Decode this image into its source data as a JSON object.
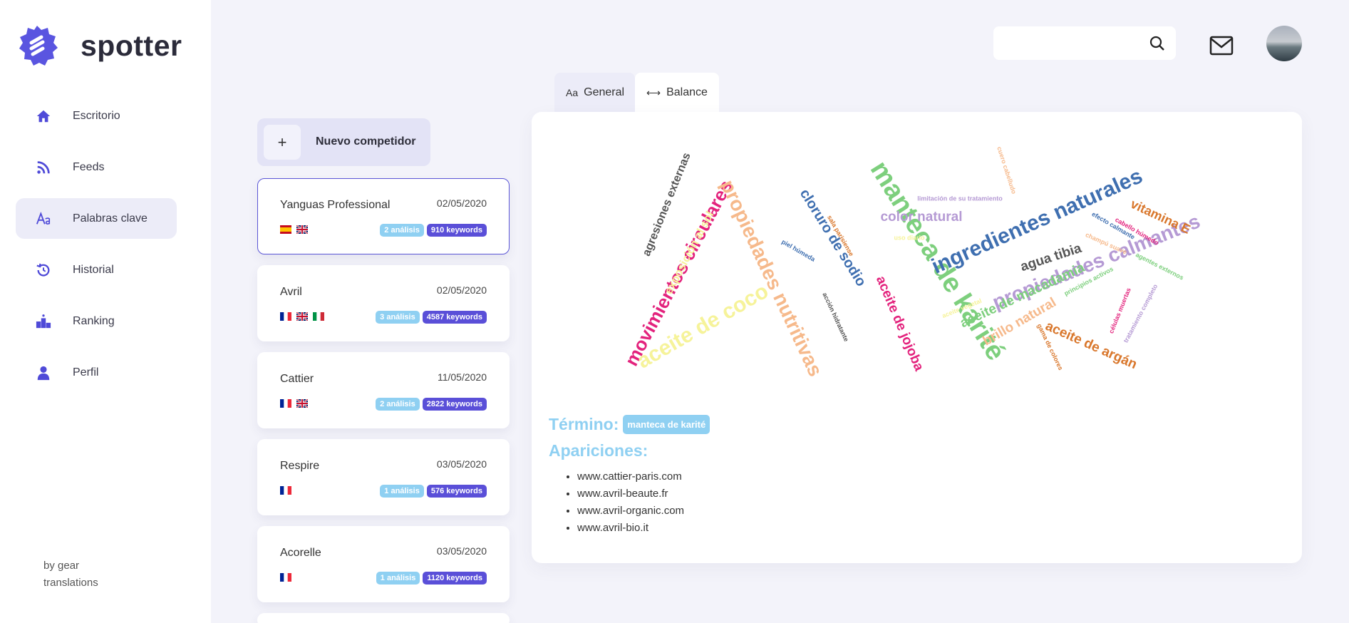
{
  "app": {
    "name": "spotter"
  },
  "sidebar": {
    "items": [
      {
        "label": "Escritorio",
        "icon": "home-icon"
      },
      {
        "label": "Feeds",
        "icon": "rss-icon"
      },
      {
        "label": "Palabras clave",
        "icon": "text-aa-icon",
        "active": true
      },
      {
        "label": "Historial",
        "icon": "history-icon"
      },
      {
        "label": "Ranking",
        "icon": "podium-icon"
      },
      {
        "label": "Perfil",
        "icon": "user-icon"
      }
    ],
    "credit": "by gear translations"
  },
  "header": {
    "search_placeholder": ""
  },
  "competitors": {
    "new_label": "Nuevo competidor",
    "new_icon": "+",
    "list": [
      {
        "name": "Yanguas Professional",
        "date": "02/05/2020",
        "flags": [
          "es",
          "gb"
        ],
        "analisis": "2 análisis",
        "keywords": "910 keywords",
        "selected": true
      },
      {
        "name": "Avril",
        "date": "02/05/2020",
        "flags": [
          "fr",
          "gb",
          "it"
        ],
        "analisis": "3 análisis",
        "keywords": "4587 keywords"
      },
      {
        "name": "Cattier",
        "date": "11/05/2020",
        "flags": [
          "fr",
          "gb"
        ],
        "analisis": "2 análisis",
        "keywords": "2822 keywords"
      },
      {
        "name": "Respire",
        "date": "03/05/2020",
        "flags": [
          "fr"
        ],
        "analisis": "1 análisis",
        "keywords": "576 keywords"
      },
      {
        "name": "Acorelle",
        "date": "03/05/2020",
        "flags": [
          "fr"
        ],
        "analisis": "1 análisis",
        "keywords": "1120 keywords"
      }
    ]
  },
  "tabs": [
    {
      "label": "General",
      "icon": "Aa"
    },
    {
      "label": "Balance",
      "icon": "⟷"
    }
  ],
  "wordcloud": [
    {
      "text": "manteca de karité",
      "color": "#7dcf7d"
    },
    {
      "text": "ingredientes naturales",
      "color": "#3f6fb0"
    },
    {
      "text": "propiedades calmantes",
      "color": "#b59ad4"
    },
    {
      "text": "movimientos circulares",
      "color": "#e3237d"
    },
    {
      "text": "propiedades nutritivas",
      "color": "#f6b98b"
    },
    {
      "text": "aceite de coco",
      "color": "#f6f39a"
    },
    {
      "text": "agresiones externas",
      "color": "#555555"
    },
    {
      "text": "exposición al sol",
      "color": "#f6f39a"
    },
    {
      "text": "cloruro de sodio",
      "color": "#3f6fb0"
    },
    {
      "text": "aceite de jojoba",
      "color": "#e3237d"
    },
    {
      "text": "color natural",
      "color": "#b59ad4"
    },
    {
      "text": "agua tibia",
      "color": "#555555"
    },
    {
      "text": "aceite de macadamia",
      "color": "#7dcf7d"
    },
    {
      "text": "brillo natural",
      "color": "#f6b98b"
    },
    {
      "text": "aceite de argán",
      "color": "#d9772c"
    },
    {
      "text": "vitamina E",
      "color": "#d9772c"
    },
    {
      "text": "limitación de su tratamiento",
      "color": "#b59ad4"
    },
    {
      "text": "cuero cabelludo",
      "color": "#f6b98b"
    },
    {
      "text": "sala parisiense",
      "color": "#d9772c"
    },
    {
      "text": "piel húmeda",
      "color": "#3f6fb0"
    },
    {
      "text": "acción hidratante",
      "color": "#555555"
    },
    {
      "text": "efecto calmante",
      "color": "#3f6fb0"
    },
    {
      "text": "cabello húmedo",
      "color": "#e3237d"
    },
    {
      "text": "champú suave",
      "color": "#f6b98b"
    },
    {
      "text": "agentes externos",
      "color": "#7dcf7d"
    },
    {
      "text": "principios activos",
      "color": "#7dcf7d"
    },
    {
      "text": "células muertas",
      "color": "#e3237d"
    },
    {
      "text": "tratamiento completo",
      "color": "#b59ad4"
    },
    {
      "text": "gama de colores",
      "color": "#d9772c"
    },
    {
      "text": "aceite vegetal",
      "color": "#f6f39a"
    },
    {
      "text": "uso diario",
      "color": "#f6f39a"
    }
  ],
  "term": {
    "label": "Término:",
    "value": "manteca de karité"
  },
  "apariciones": {
    "label": "Apariciones:",
    "sites": [
      "www.cattier-paris.com",
      "www.avril-beaute.fr",
      "www.avril-organic.com",
      "www.avril-bio.it"
    ]
  }
}
